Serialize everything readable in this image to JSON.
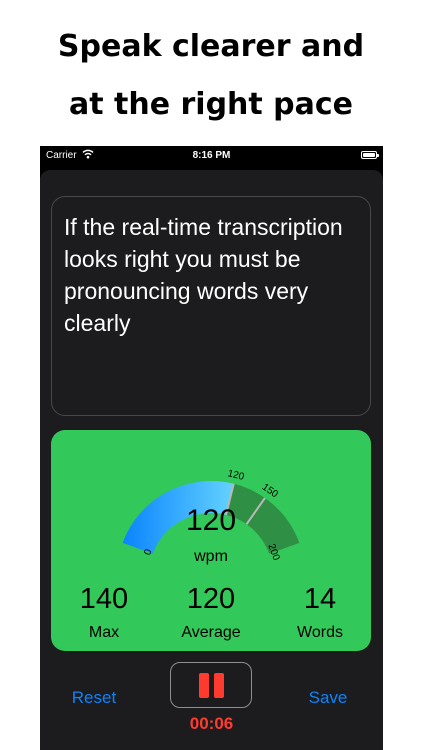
{
  "headline": {
    "line1": "Speak clearer and",
    "line2": "at the right pace"
  },
  "status_bar": {
    "carrier": "Carrier",
    "time": "8:16 PM"
  },
  "transcription": {
    "text": "If the real-time transcription looks right you must be pronouncing words very clearly"
  },
  "gauge": {
    "min": 0,
    "max": 200,
    "ticks": [
      {
        "value": 0,
        "label": "0"
      },
      {
        "value": 120,
        "label": "120"
      },
      {
        "value": 150,
        "label": "150"
      },
      {
        "value": 200,
        "label": "200"
      }
    ],
    "current_value": 120,
    "current_display": "120",
    "unit": "wpm",
    "colors": {
      "fill_start": "#0a84ff",
      "fill_end": "#64d2ff",
      "zone": "#2f8f45",
      "divider": "#b8b8b8"
    }
  },
  "stats": {
    "max": {
      "value": "140",
      "label": "Max"
    },
    "average": {
      "value": "120",
      "label": "Average"
    },
    "words": {
      "value": "14",
      "label": "Words"
    }
  },
  "controls": {
    "reset_label": "Reset",
    "save_label": "Save",
    "elapsed": "00:06"
  },
  "colors": {
    "card_green": "#33c85a",
    "accent_blue": "#0a84ff",
    "record_red": "#ff3b30"
  }
}
